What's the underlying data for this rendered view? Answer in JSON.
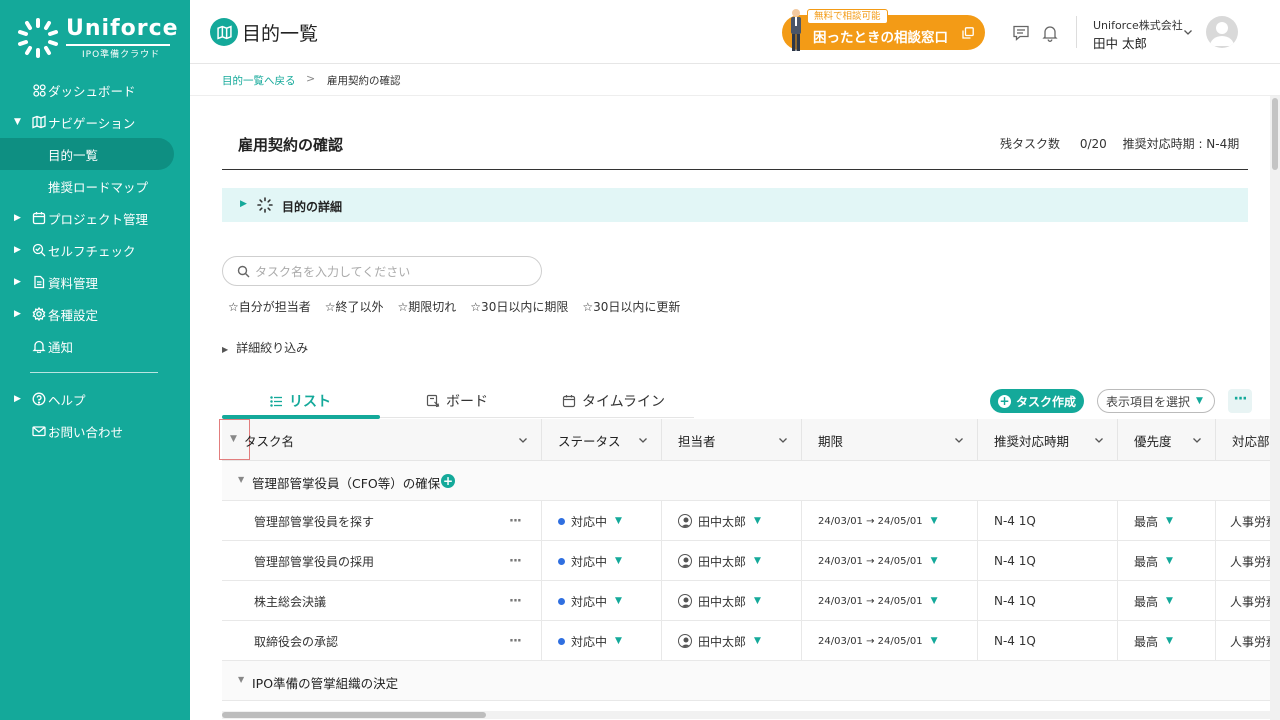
{
  "brand": {
    "name": "Uniforce",
    "sub": "IPO準備クラウド"
  },
  "sidebar": {
    "items": [
      {
        "label": "ダッシュボード",
        "caret": "",
        "icon": "dashboard-icon"
      },
      {
        "label": "ナビゲーション",
        "caret": "▼",
        "icon": "map-icon"
      },
      {
        "label": "目的一覧",
        "caret": "",
        "icon": "",
        "active": true
      },
      {
        "label": "推奨ロードマップ",
        "caret": "",
        "icon": ""
      },
      {
        "label": "プロジェクト管理",
        "caret": "▶",
        "icon": "calendar-icon"
      },
      {
        "label": "セルフチェック",
        "caret": "▶",
        "icon": "check-search-icon"
      },
      {
        "label": "資料管理",
        "caret": "▶",
        "icon": "document-icon"
      },
      {
        "label": "各種設定",
        "caret": "▶",
        "icon": "gear-icon"
      },
      {
        "label": "通知",
        "caret": "",
        "icon": "bell-icon"
      },
      {
        "label": "ヘルプ",
        "caret": "▶",
        "icon": "help-icon"
      },
      {
        "label": "お問い合わせ",
        "caret": "",
        "icon": "mail-icon"
      }
    ]
  },
  "header": {
    "title": "目的一覧",
    "consult_badge": "無料で相談可能",
    "consult_label": "困ったときの相談窓口",
    "company": "Uniforce株式会社",
    "user": "田中 太郎"
  },
  "breadcrumb": {
    "back": "目的一覧へ戻る",
    "sep": ">",
    "current": "雇用契約の確認"
  },
  "goal": {
    "title": "雇用契約の確認",
    "remaining_label": "残タスク数",
    "remaining_value": "0/20",
    "period": "推奨対応時期 : N-4期",
    "detail_label": "目的の詳細"
  },
  "search": {
    "placeholder": "タスク名を入力してください"
  },
  "filters": [
    "☆自分が担当者",
    "☆終了以外",
    "☆期限切れ",
    "☆30日以内に期限",
    "☆30日以内に更新"
  ],
  "advanced_filter": "詳細絞り込み",
  "tabs": [
    {
      "label": "リスト",
      "active": true
    },
    {
      "label": "ボード",
      "active": false
    },
    {
      "label": "タイムライン",
      "active": false
    }
  ],
  "toolbar": {
    "create": "タスク作成",
    "columns": "表示項目を選択",
    "more": "···"
  },
  "table": {
    "columns": [
      "タスク名",
      "ステータス",
      "担当者",
      "期限",
      "推奨対応時期",
      "優先度",
      "対応部署"
    ],
    "groups": [
      {
        "name": "管理部管掌役員（CFO等）の確保",
        "rows": [
          {
            "task": "管理部管掌役員を探す",
            "status": "対応中",
            "assignee": "田中太郎",
            "due": "24/03/01 → 24/05/01",
            "period": "N-4  1Q",
            "priority": "最高",
            "dept": "人事労務"
          },
          {
            "task": "管理部管掌役員の採用",
            "status": "対応中",
            "assignee": "田中太郎",
            "due": "24/03/01 → 24/05/01",
            "period": "N-4  1Q",
            "priority": "最高",
            "dept": "人事労務"
          },
          {
            "task": "株主総会決議",
            "status": "対応中",
            "assignee": "田中太郎",
            "due": "24/03/01 → 24/05/01",
            "period": "N-4  1Q",
            "priority": "最高",
            "dept": "人事労務"
          },
          {
            "task": "取締役会の承認",
            "status": "対応中",
            "assignee": "田中太郎",
            "due": "24/03/01 → 24/05/01",
            "period": "N-4  1Q",
            "priority": "最高",
            "dept": "人事労務"
          }
        ]
      },
      {
        "name": "IPO準備の管掌組織の決定",
        "rows": []
      }
    ]
  },
  "colors": {
    "accent": "#14a99a",
    "orange": "#f39b16",
    "status_blue": "#2f6fe0"
  }
}
